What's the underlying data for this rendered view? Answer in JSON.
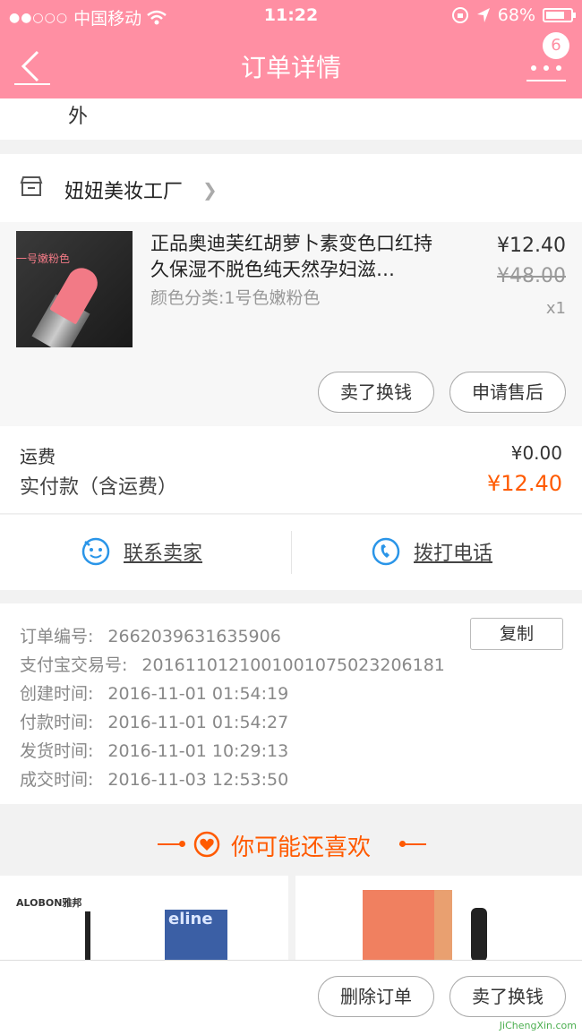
{
  "status_bar": {
    "carrier": "中国移动",
    "time": "11:22",
    "battery": "68%"
  },
  "nav": {
    "title": "订单详情",
    "badge": "6"
  },
  "address_tail": "外",
  "shop": {
    "name": "妞妞美妆工厂"
  },
  "product": {
    "thumb_label": "一号嫩粉色",
    "title": "正品奥迪芙红胡萝卜素变色口红持久保湿不脱色纯天然孕妇滋…",
    "sku": "颜色分类:1号色嫩粉色",
    "price": "¥12.40",
    "original_price": "¥48.00",
    "qty": "x1",
    "sell_button": "卖了换钱",
    "after_sale_button": "申请售后"
  },
  "fees": {
    "shipping_label": "运费",
    "shipping_value": "¥0.00",
    "paid_label": "实付款（含运费）",
    "paid_value": "¥12.40"
  },
  "contact": {
    "seller": "联系卖家",
    "phone": "拨打电话"
  },
  "order_info": {
    "copy_button": "复制",
    "rows": [
      {
        "k": "订单编号:",
        "v": "2662039631635906"
      },
      {
        "k": "支付宝交易号:",
        "v": "2016110121001001075023206181"
      },
      {
        "k": "创建时间:",
        "v": "2016-11-01 01:54:19"
      },
      {
        "k": "付款时间:",
        "v": "2016-11-01 01:54:27"
      },
      {
        "k": "发货时间:",
        "v": "2016-11-01 10:29:13"
      },
      {
        "k": "成交时间:",
        "v": "2016-11-03 12:53:50"
      }
    ]
  },
  "recommend": {
    "title": "你可能还喜欢",
    "goods_1_brand": "ALOBON雅邦",
    "goods_1_box_text": "eline"
  },
  "bottom": {
    "delete_button": "删除订单",
    "sell_button": "卖了换钱"
  },
  "watermark": "JiChengXin.com",
  "colors": {
    "header": "#ff8fa3",
    "accent": "#ff5a00",
    "link_icon": "#2a95e8"
  }
}
